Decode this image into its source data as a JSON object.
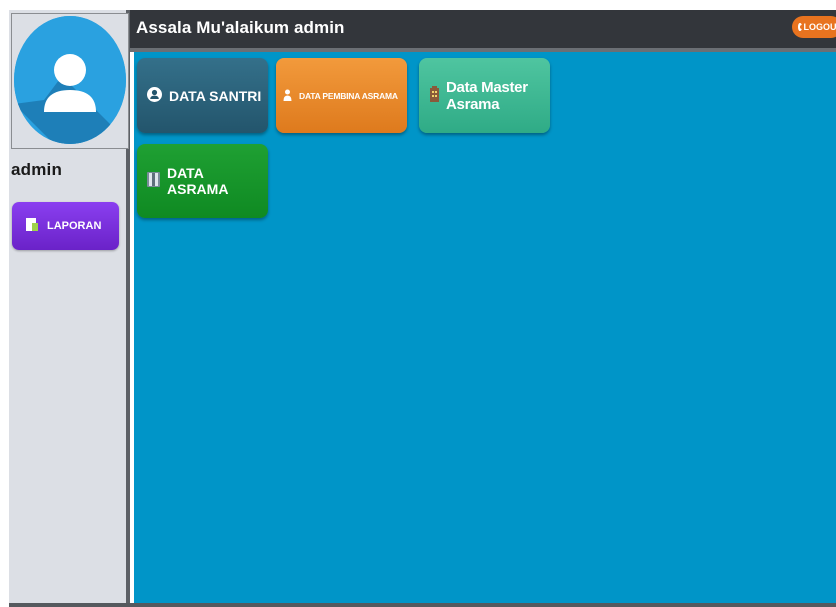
{
  "header": {
    "greeting": "Assala Mu'alaikum admin",
    "logout_label": "LOGOUT"
  },
  "sidebar": {
    "username": "admin",
    "laporan_label": "LAPORAN"
  },
  "tiles": {
    "santri": "DATA SANTRI",
    "pembina": "DATA PEMBINA ASRAMA",
    "master": "Data Master Asrama",
    "asrama": "DATA ASRAMA"
  },
  "colors": {
    "main_bg": "#0095c8",
    "topbar_bg": "#33363b",
    "sidebar_bg": "#dcdfe5",
    "santri": "#2d6a83",
    "pembina": "#e98a2c",
    "master": "#3fba94",
    "asrama": "#18962c",
    "laporan": "#7a30dc",
    "logout": "#e8731f"
  },
  "icons": {
    "avatar": "user-avatar-icon",
    "santri": "user-circle-icon",
    "pembina": "user-icon",
    "master": "building-icon",
    "asrama": "book-icon",
    "laporan": "document-icon",
    "logout": "power-icon"
  }
}
